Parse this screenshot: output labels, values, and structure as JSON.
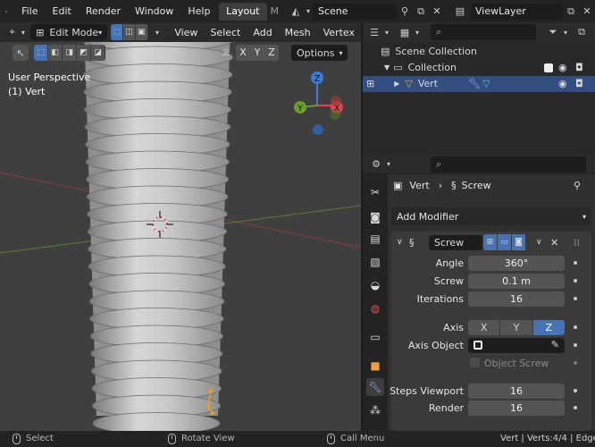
{
  "menubar": {
    "items": [
      "File",
      "Edit",
      "Render",
      "Window",
      "Help"
    ],
    "workspace_active": "Layout",
    "workspace_next": "M",
    "scene_name": "Scene",
    "view_layer_name": "ViewLayer"
  },
  "viewport": {
    "mode": "Edit Mode",
    "menus": [
      "View",
      "Select",
      "Add",
      "Mesh",
      "Vertex"
    ],
    "axis_buttons": [
      "X",
      "Y",
      "Z"
    ],
    "options_label": "Options",
    "overlay_line1": "User Perspective",
    "overlay_line2": "(1) Vert",
    "gizmo_axis_labels": [
      "Z",
      "Y",
      "X"
    ]
  },
  "outliner": {
    "rows": [
      {
        "label": "Scene Collection"
      },
      {
        "label": "Collection"
      },
      {
        "label": "Vert"
      }
    ]
  },
  "properties": {
    "breadcrumb_object": "Vert",
    "breadcrumb_modifier": "Screw",
    "add_modifier_label": "Add Modifier",
    "modifier_name": "Screw",
    "fields": [
      {
        "label": "Angle",
        "value": "360°"
      },
      {
        "label": "Screw",
        "value": "0.1 m"
      },
      {
        "label": "Iterations",
        "value": "16"
      }
    ],
    "axis_label": "Axis",
    "axis_options": [
      "X",
      "Y",
      "Z"
    ],
    "axis_selected": "Z",
    "axis_object_label": "Axis Object",
    "object_screw_label": "Object Screw",
    "steps_viewport_label": "Steps Viewport",
    "steps_viewport_value": "16",
    "render_label": "Render",
    "render_value": "16"
  },
  "statusbar": {
    "select": "Select",
    "rotate_view": "Rotate View",
    "call_menu": "Call Menu",
    "stats": "Vert | Verts:4/4 | Edge"
  },
  "colors": {
    "accent_blue": "#4772b3",
    "selected_row": "#334d80",
    "axis_x": "#e2424d",
    "axis_y": "#6b9c2f",
    "axis_z": "#3a7cd8",
    "vertex_orange": "#f29a1f"
  }
}
